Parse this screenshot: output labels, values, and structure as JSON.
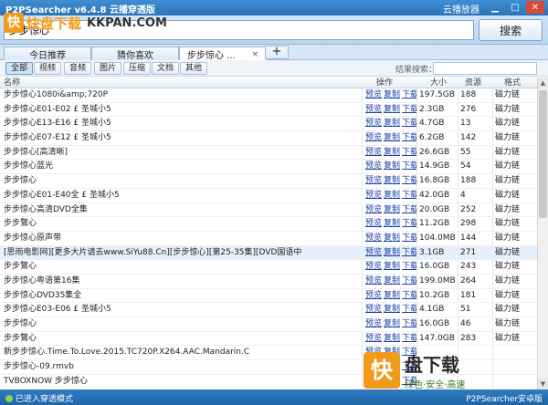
{
  "window": {
    "title": "P2PSearcher v6.4.8 云播穿透版",
    "mode_label": "云播放器",
    "controls": [
      "▁",
      "□",
      "✕"
    ]
  },
  "search": {
    "value": "步步惊心",
    "button_label": "搜索"
  },
  "tabs": [
    {
      "label": "今日推荐",
      "active": false
    },
    {
      "label": "猜你喜欢",
      "active": false
    },
    {
      "label": "步步惊心 ...",
      "active": true,
      "close": "×"
    }
  ],
  "tab_add_label": "+",
  "filters": [
    "全部",
    "视频",
    "音频",
    "图片",
    "压缩",
    "文档",
    "其他"
  ],
  "result_search_label": "结果搜索：",
  "table": {
    "headers": {
      "name": "名称",
      "actions": "操作",
      "size": "大小",
      "sources": "资源",
      "format": "格式"
    },
    "action_labels": [
      "预览",
      "复制",
      "下载"
    ],
    "rows": [
      {
        "name": "步步惊心1080i&amp;720P",
        "size": "197.5GB",
        "sources": "188",
        "format": "磁力链"
      },
      {
        "name": "步步惊心E01-E02 £ 圣城小5",
        "size": "2.3GB",
        "sources": "276",
        "format": "磁力链"
      },
      {
        "name": "步步惊心E13-E16 £ 圣城小5",
        "size": "4.7GB",
        "sources": "13",
        "format": "磁力链"
      },
      {
        "name": "步步惊心E07-E12 £ 圣城小5",
        "size": "6.2GB",
        "sources": "142",
        "format": "磁力链"
      },
      {
        "name": "步步惊心[高清晰]",
        "size": "26.6GB",
        "sources": "55",
        "format": "磁力链"
      },
      {
        "name": "步步惊心蓝光",
        "size": "14.9GB",
        "sources": "54",
        "format": "磁力链"
      },
      {
        "name": "步步惊心",
        "size": "16.8GB",
        "sources": "188",
        "format": "磁力链"
      },
      {
        "name": "步步惊心E01-E40全 £ 圣城小5",
        "size": "42.0GB",
        "sources": "4",
        "format": "磁力链"
      },
      {
        "name": "步步惊心高清DVD全集",
        "size": "20.0GB",
        "sources": "252",
        "format": "磁力链"
      },
      {
        "name": "步步鷩心",
        "size": "11.2GB",
        "sources": "298",
        "format": "磁力链"
      },
      {
        "name": "步步惊心原声带",
        "size": "104.0MB",
        "sources": "144",
        "format": "磁力链"
      },
      {
        "name": "[思雨电影网][更多大片请去www.SiYu88.Cn][步步惊心][第25-35集][DVD国语中",
        "size": "3.1GB",
        "sources": "271",
        "format": "磁力链",
        "highlight": true
      },
      {
        "name": "步步鷩心",
        "size": "16.0GB",
        "sources": "243",
        "format": "磁力链"
      },
      {
        "name": "步步惊心粤语第16集",
        "size": "199.0MB",
        "sources": "264",
        "format": "磁力链"
      },
      {
        "name": "步步惊心DVD35集全",
        "size": "10.2GB",
        "sources": "181",
        "format": "磁力链"
      },
      {
        "name": "步步惊心E03-E06 £ 圣城小5",
        "size": "4.1GB",
        "sources": "51",
        "format": "磁力链"
      },
      {
        "name": "步步惊心",
        "size": "16.0GB",
        "sources": "46",
        "format": "磁力链"
      },
      {
        "name": "步步鷩心",
        "size": "147.0GB",
        "sources": "283",
        "format": "磁力链"
      },
      {
        "name": "新步步惊心.Time.To.Love.2015.TC720P.X264.AAC.Mandarin.C",
        "size": "",
        "sources": "",
        "format": ""
      },
      {
        "name": "步步惊心-09.rmvb",
        "size": "",
        "sources": "",
        "format": ""
      },
      {
        "name": "TVBOXNOW 步步惊心",
        "size": "",
        "sources": "",
        "format": ""
      }
    ]
  },
  "status": {
    "left": "已进入穿透模式",
    "right": "P2PSearcher安卓版"
  },
  "watermark_top": {
    "logo": "快",
    "text": "快盘下载",
    "sub": "KKPAN.COM"
  },
  "watermark_bottom": {
    "logo": "快",
    "title": "盘下载",
    "tagline": "绿色·安全·高速"
  }
}
